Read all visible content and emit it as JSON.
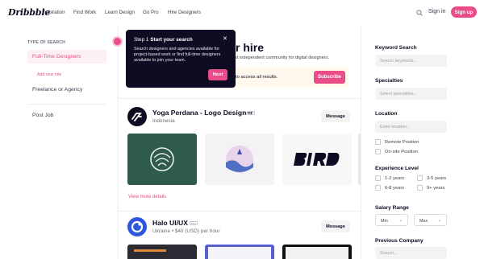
{
  "nav": {
    "logo": "Dribbble",
    "links": [
      "Inspiration",
      "Find Work",
      "Learn Design",
      "Go Pro",
      "Hire Designers"
    ],
    "sign_in": "Sign in",
    "sign_up": "Sign up"
  },
  "sidebar": {
    "heading": "TYPE OF SEARCH",
    "active_item": "Full-Time Designers",
    "add_role": "Add new role",
    "item_freelance": "Freelance or Agency",
    "item_post_job": "Post Job"
  },
  "tour": {
    "step": "Step 1",
    "title": "Start your search",
    "body": "Search designers and agencies available for project-based work or find full-time designers available to join your team.",
    "next": "Next"
  },
  "main": {
    "hero_title_fragment": "r hire",
    "hero_sub_fragment": "est independent community for digital designers.",
    "promo_text": "to access all results.",
    "subscribe": "Subscribe"
  },
  "designers": [
    {
      "name": "Yoga Perdana - Logo Designer",
      "badge": "PRO",
      "location": "Indonesia",
      "message": "Message",
      "view_more": "View more details"
    },
    {
      "name": "Halo UI/UX",
      "badge": "PRO",
      "location": "Ukraine",
      "rate": "$40 (USD) per hour",
      "message": "Message"
    }
  ],
  "filters": {
    "keyword_label": "Keyword Search",
    "keyword_placeholder": "Search keywords...",
    "specialties_label": "Specialties",
    "specialties_placeholder": "Select specialties...",
    "location_label": "Location",
    "location_placeholder": "Enter location...",
    "remote": "Remote Position",
    "onsite": "On-site Position",
    "experience_label": "Experience Level",
    "exp_options": [
      "1-2 years",
      "3-5 years",
      "6-8 years",
      "9+ years"
    ],
    "salary_label": "Salary Range",
    "salary_min": "Min",
    "salary_max": "Max",
    "prev_company_label": "Previous Company",
    "prev_company_placeholder": "Search..."
  },
  "colors": {
    "accent": "#ea4c89",
    "dark": "#0d0c22",
    "shot_green": "#2f5b4c"
  }
}
